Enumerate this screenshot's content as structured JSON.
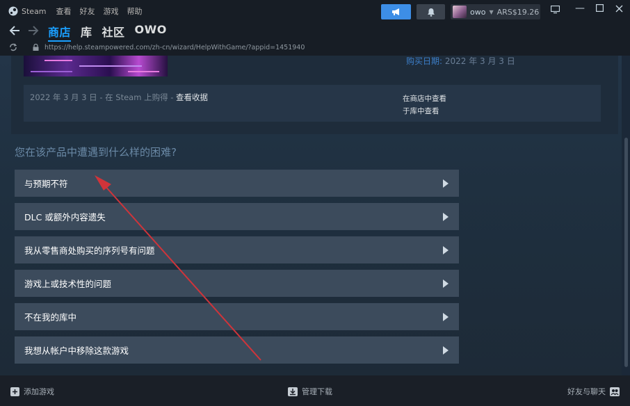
{
  "titlebar": {
    "app_name": "Steam",
    "menu": [
      "查看",
      "好友",
      "游戏",
      "帮助"
    ],
    "username": "owo",
    "balance": "ARS$19.26"
  },
  "nav": {
    "links": [
      "商店",
      "库",
      "社区",
      "OWO"
    ],
    "active": "商店"
  },
  "urlbar": {
    "url": "https://help.steampowered.com/zh-cn/wizard/HelpWithGame/?appid=1451940"
  },
  "product": {
    "purchase_date_label": "购买日期:",
    "purchase_date_value": "2022 年 3 月 3 日",
    "purchase_line_prefix": "2022 年 3 月 3 日 - 在 Steam 上购得 -",
    "view_receipt": "查看收据",
    "view_in_store": "在商店中查看",
    "view_in_library": "于库中查看"
  },
  "question": "您在该产品中遭遇到什么样的困难?",
  "options": [
    "与预期不符",
    "DLC 或额外内容遗失",
    "我从零售商处购买的序列号有问题",
    "游戏上或技术性的问题",
    "不在我的库中",
    "我想从帐户中移除这款游戏"
  ],
  "bottombar": {
    "add_game": "添加游戏",
    "manage_downloads": "管理下载",
    "friends_chat": "好友与聊天"
  },
  "colors": {
    "accent": "#1a9fff",
    "announce_button": "#3d8ee6",
    "annotation_arrow": "#d0343a"
  }
}
